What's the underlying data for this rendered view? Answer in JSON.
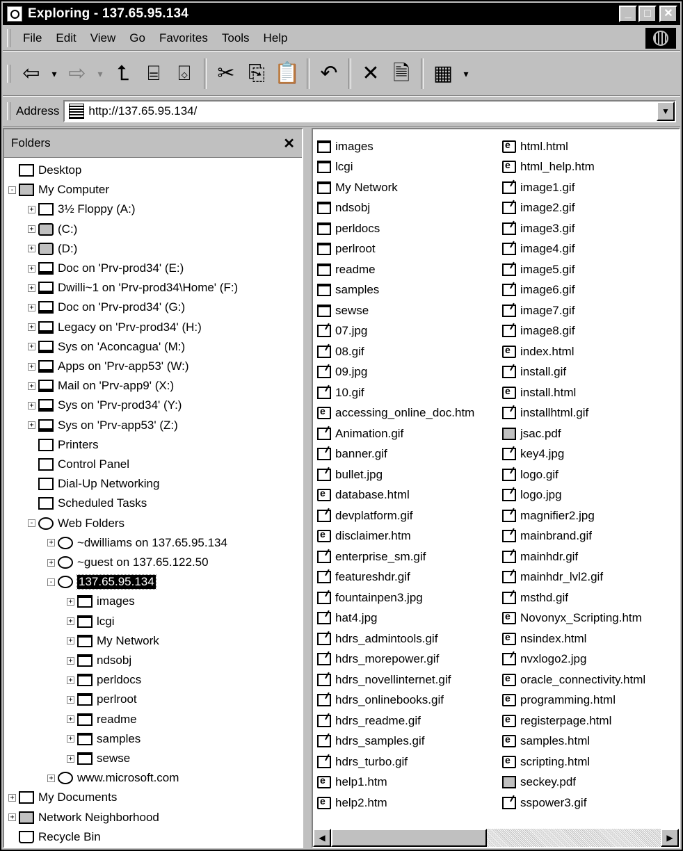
{
  "window": {
    "title": "Exploring - 137.65.95.134",
    "min_glyph": "_",
    "max_glyph": "□",
    "close_glyph": "✕"
  },
  "menu": [
    "File",
    "Edit",
    "View",
    "Go",
    "Favorites",
    "Tools",
    "Help"
  ],
  "address": {
    "label": "Address",
    "value": "http://137.65.95.134/"
  },
  "folders_pane": {
    "title": "Folders",
    "close_glyph": "✕",
    "tree": [
      {
        "label": "Desktop",
        "icon": "desktop-icon"
      },
      {
        "label": "My Computer",
        "icon": "computer-icon"
      },
      {
        "label": "3½ Floppy (A:)",
        "icon": "floppy-icon"
      },
      {
        "label": "(C:)",
        "icon": "hard-drive-icon"
      },
      {
        "label": "(D:)",
        "icon": "cd-drive-icon"
      },
      {
        "label": "Doc on 'Prv-prod34' (E:)",
        "icon": "network-drive-icon"
      },
      {
        "label": "Dwilli~1 on 'Prv-prod34\\Home' (F:)",
        "icon": "network-drive-icon"
      },
      {
        "label": "Doc on 'Prv-prod34' (G:)",
        "icon": "network-drive-icon"
      },
      {
        "label": "Legacy on 'Prv-prod34' (H:)",
        "icon": "network-drive-icon"
      },
      {
        "label": "Sys on 'Aconcagua' (M:)",
        "icon": "network-drive-icon"
      },
      {
        "label": "Apps on 'Prv-app53' (W:)",
        "icon": "network-drive-icon"
      },
      {
        "label": "Mail on 'Prv-app9' (X:)",
        "icon": "network-drive-icon"
      },
      {
        "label": "Sys on 'Prv-prod34' (Y:)",
        "icon": "network-drive-icon"
      },
      {
        "label": "Sys on 'Prv-app53' (Z:)",
        "icon": "network-drive-icon"
      },
      {
        "label": "Printers",
        "icon": "printers-icon"
      },
      {
        "label": "Control Panel",
        "icon": "control-panel-icon"
      },
      {
        "label": "Dial-Up Networking",
        "icon": "dialup-icon"
      },
      {
        "label": "Scheduled Tasks",
        "icon": "scheduled-tasks-icon"
      },
      {
        "label": "Web Folders",
        "icon": "web-folders-icon"
      },
      {
        "label": "~dwilliams on 137.65.95.134",
        "icon": "web-folder-icon"
      },
      {
        "label": "~guest on 137.65.122.50",
        "icon": "web-folder-icon"
      },
      {
        "label": "137.65.95.134",
        "icon": "web-folder-icon"
      },
      {
        "label": "images",
        "icon": "folder-icon"
      },
      {
        "label": "lcgi",
        "icon": "folder-icon"
      },
      {
        "label": "My Network",
        "icon": "folder-icon"
      },
      {
        "label": "ndsobj",
        "icon": "folder-icon"
      },
      {
        "label": "perldocs",
        "icon": "folder-icon"
      },
      {
        "label": "perlroot",
        "icon": "folder-icon"
      },
      {
        "label": "readme",
        "icon": "folder-icon"
      },
      {
        "label": "samples",
        "icon": "folder-icon"
      },
      {
        "label": "sewse",
        "icon": "folder-icon"
      },
      {
        "label": "www.microsoft.com",
        "icon": "web-folder-icon"
      },
      {
        "label": "My Documents",
        "icon": "my-documents-icon"
      },
      {
        "label": "Network Neighborhood",
        "icon": "network-neighborhood-icon"
      },
      {
        "label": "Recycle Bin",
        "icon": "recycle-bin-icon"
      }
    ]
  },
  "files_col1": [
    {
      "name": "images",
      "type": "folder"
    },
    {
      "name": "lcgi",
      "type": "folder"
    },
    {
      "name": "My Network",
      "type": "folder"
    },
    {
      "name": "ndsobj",
      "type": "folder"
    },
    {
      "name": "perldocs",
      "type": "folder"
    },
    {
      "name": "perlroot",
      "type": "folder"
    },
    {
      "name": "readme",
      "type": "folder"
    },
    {
      "name": "samples",
      "type": "folder"
    },
    {
      "name": "sewse",
      "type": "folder"
    },
    {
      "name": "07.jpg",
      "type": "image"
    },
    {
      "name": "08.gif",
      "type": "image"
    },
    {
      "name": "09.jpg",
      "type": "image"
    },
    {
      "name": "10.gif",
      "type": "image"
    },
    {
      "name": "accessing_online_doc.htm",
      "type": "html"
    },
    {
      "name": "Animation.gif",
      "type": "image"
    },
    {
      "name": "banner.gif",
      "type": "image"
    },
    {
      "name": "bullet.jpg",
      "type": "image"
    },
    {
      "name": "database.html",
      "type": "html"
    },
    {
      "name": "devplatform.gif",
      "type": "image"
    },
    {
      "name": "disclaimer.htm",
      "type": "html"
    },
    {
      "name": "enterprise_sm.gif",
      "type": "image"
    },
    {
      "name": "featureshdr.gif",
      "type": "image"
    },
    {
      "name": "fountainpen3.jpg",
      "type": "image"
    },
    {
      "name": "hat4.jpg",
      "type": "image"
    },
    {
      "name": "hdrs_admintools.gif",
      "type": "image"
    },
    {
      "name": "hdrs_morepower.gif",
      "type": "image"
    },
    {
      "name": "hdrs_novellinternet.gif",
      "type": "image"
    },
    {
      "name": "hdrs_onlinebooks.gif",
      "type": "image"
    },
    {
      "name": "hdrs_readme.gif",
      "type": "image"
    },
    {
      "name": "hdrs_samples.gif",
      "type": "image"
    },
    {
      "name": "hdrs_turbo.gif",
      "type": "image"
    },
    {
      "name": "help1.htm",
      "type": "html"
    },
    {
      "name": "help2.htm",
      "type": "html"
    }
  ],
  "files_col2": [
    {
      "name": "html.html",
      "type": "html"
    },
    {
      "name": "html_help.htm",
      "type": "html"
    },
    {
      "name": "image1.gif",
      "type": "image"
    },
    {
      "name": "image2.gif",
      "type": "image"
    },
    {
      "name": "image3.gif",
      "type": "image"
    },
    {
      "name": "image4.gif",
      "type": "image"
    },
    {
      "name": "image5.gif",
      "type": "image"
    },
    {
      "name": "image6.gif",
      "type": "image"
    },
    {
      "name": "image7.gif",
      "type": "image"
    },
    {
      "name": "image8.gif",
      "type": "image"
    },
    {
      "name": "index.html",
      "type": "html"
    },
    {
      "name": "install.gif",
      "type": "image"
    },
    {
      "name": "install.html",
      "type": "html"
    },
    {
      "name": "installhtml.gif",
      "type": "image"
    },
    {
      "name": "jsac.pdf",
      "type": "pdf"
    },
    {
      "name": "key4.jpg",
      "type": "image"
    },
    {
      "name": "logo.gif",
      "type": "image"
    },
    {
      "name": "logo.jpg",
      "type": "image"
    },
    {
      "name": "magnifier2.jpg",
      "type": "image"
    },
    {
      "name": "mainbrand.gif",
      "type": "image"
    },
    {
      "name": "mainhdr.gif",
      "type": "image"
    },
    {
      "name": "mainhdr_lvl2.gif",
      "type": "image"
    },
    {
      "name": "msthd.gif",
      "type": "image"
    },
    {
      "name": "Novonyx_Scripting.htm",
      "type": "html"
    },
    {
      "name": "nsindex.html",
      "type": "html"
    },
    {
      "name": "nvxlogo2.jpg",
      "type": "image"
    },
    {
      "name": "oracle_connectivity.html",
      "type": "html"
    },
    {
      "name": "programming.html",
      "type": "html"
    },
    {
      "name": "registerpage.html",
      "type": "html"
    },
    {
      "name": "samples.html",
      "type": "html"
    },
    {
      "name": "scripting.html",
      "type": "html"
    },
    {
      "name": "seckey.pdf",
      "type": "pdf"
    },
    {
      "name": "sspower3.gif",
      "type": "image"
    }
  ]
}
